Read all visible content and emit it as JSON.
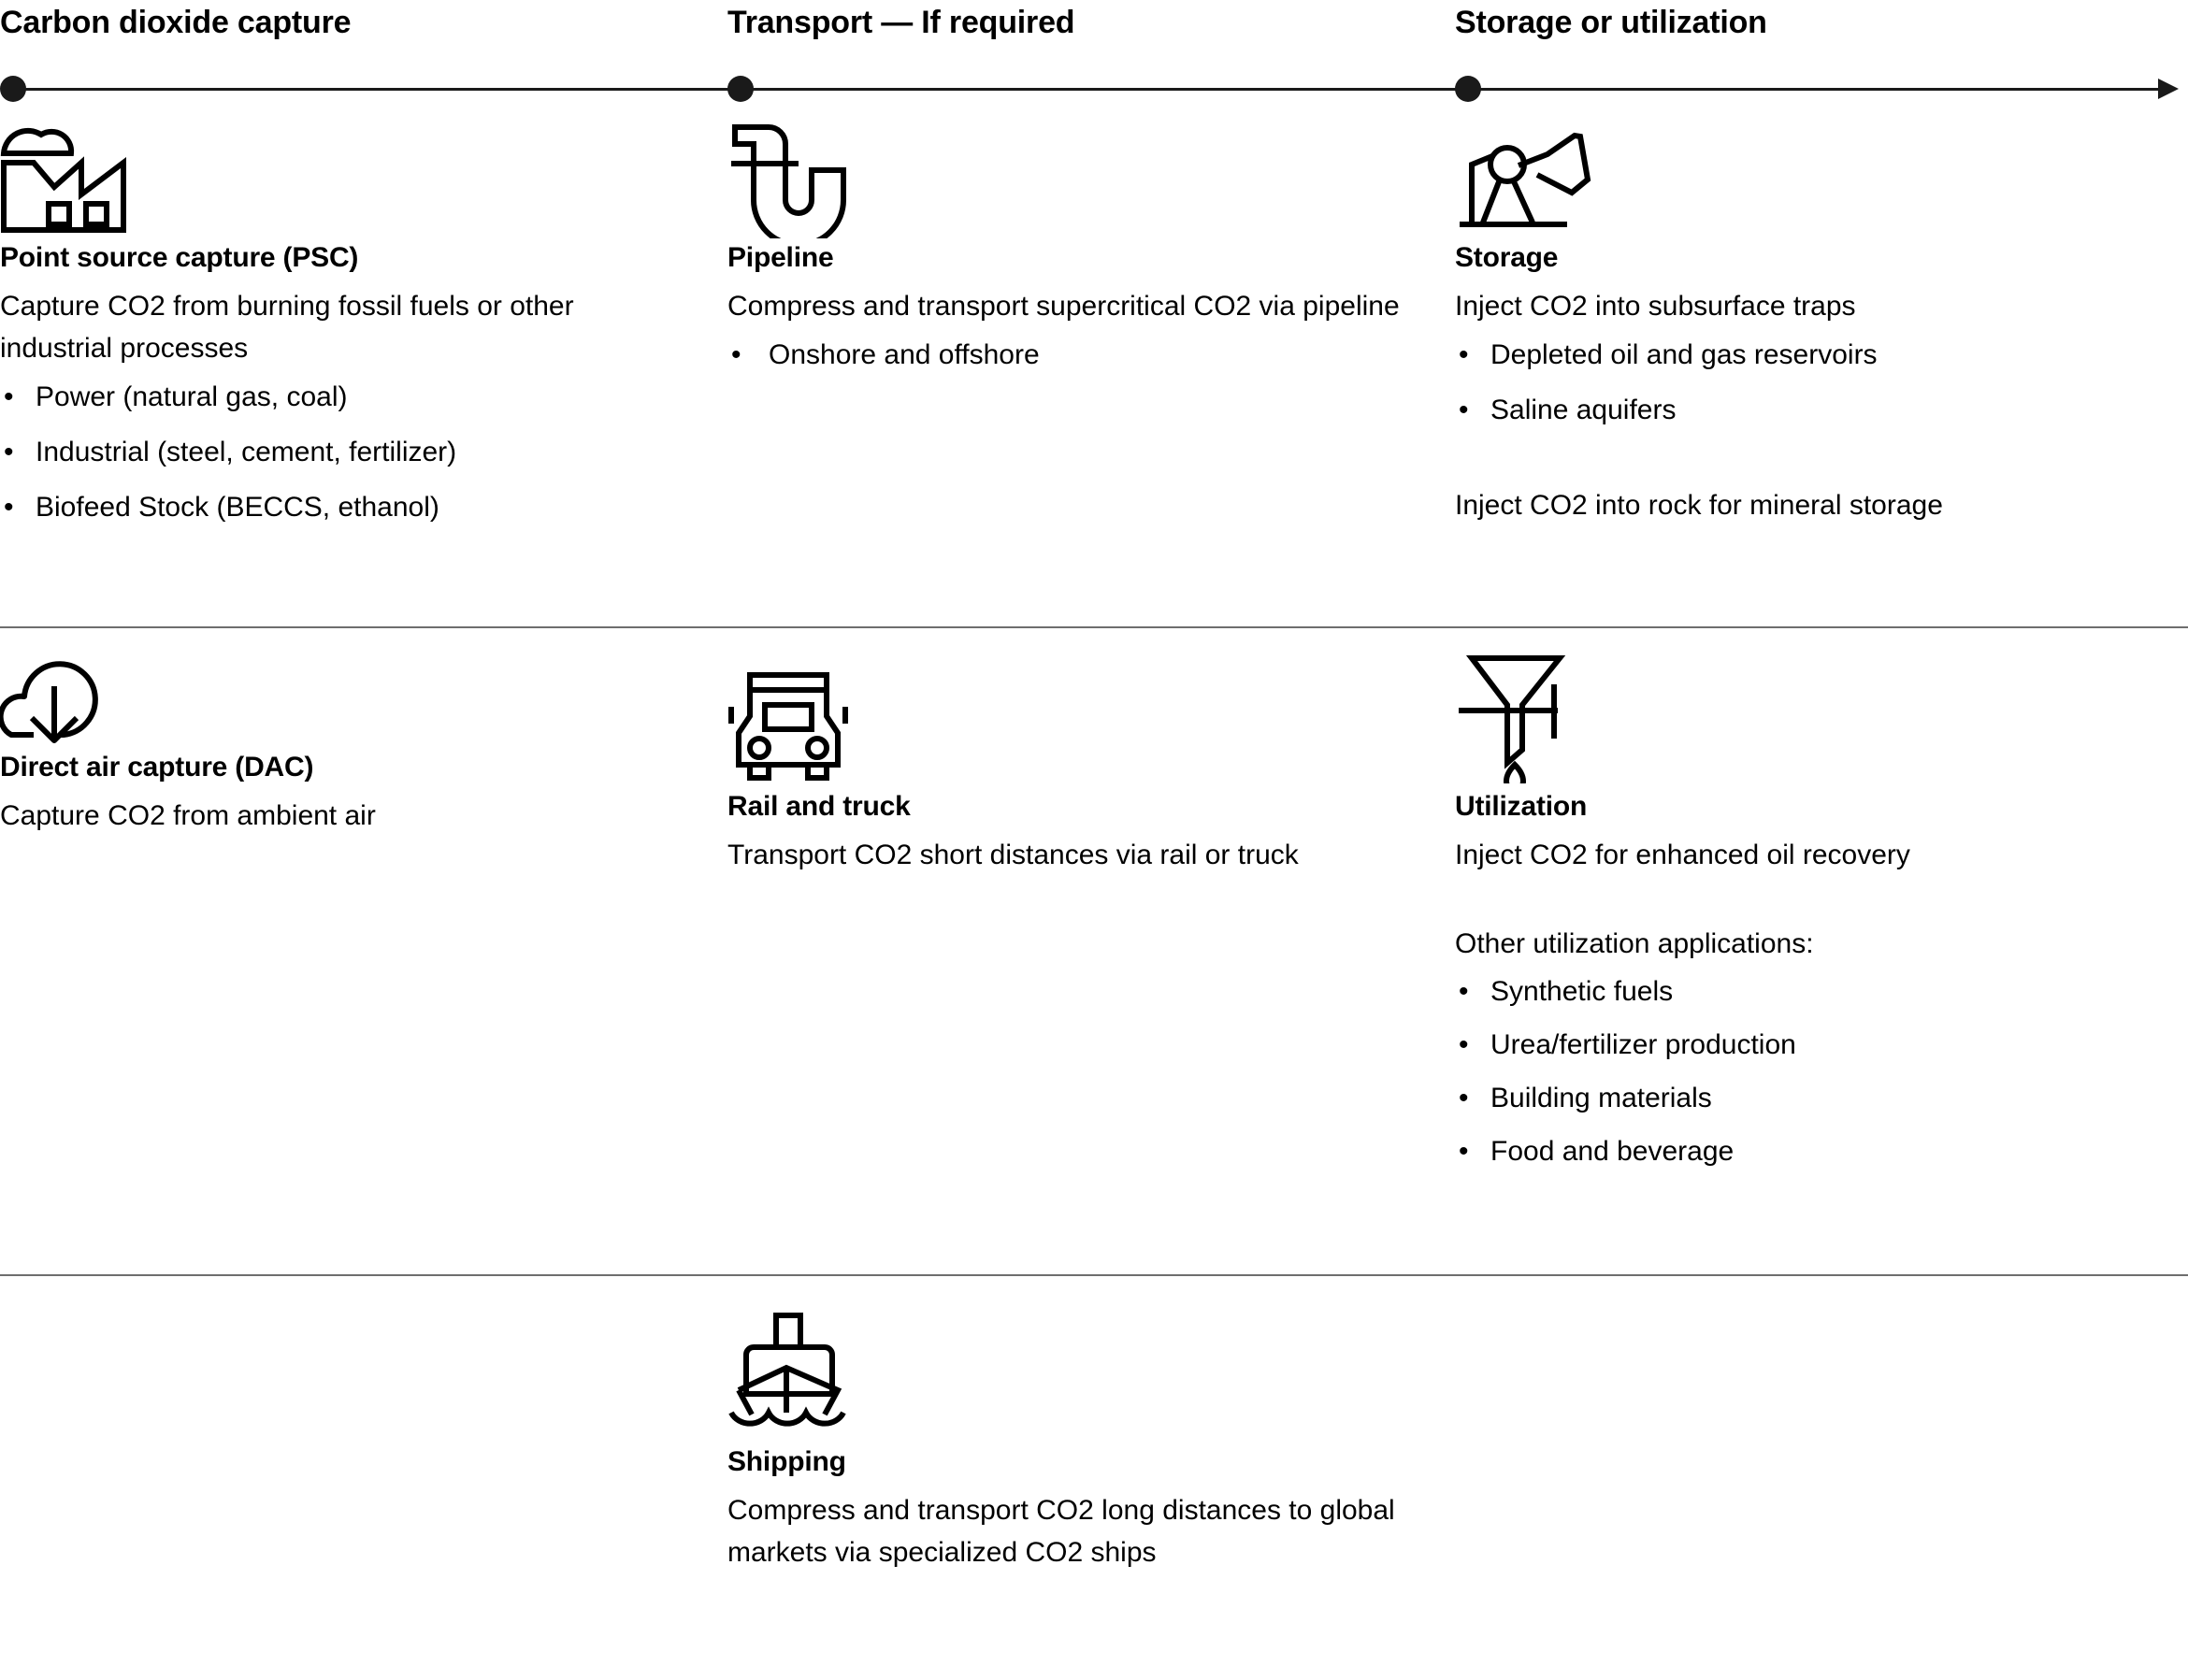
{
  "timeline": {
    "stages": [
      {
        "id": "capture",
        "label": "Carbon dioxide capture"
      },
      {
        "id": "transport",
        "label": "Transport — If required"
      },
      {
        "id": "storage",
        "label": "Storage or utilization"
      }
    ]
  },
  "cells": {
    "psc": {
      "icon": "factory-icon",
      "heading": "Point source capture (PSC)",
      "description": "Capture CO2 from burning fossil fuels or other industrial processes",
      "bullets": [
        "Power (natural gas, coal)",
        "Industrial (steel, cement, fertilizer)",
        "Biofeed Stock (BECCS, ethanol)"
      ]
    },
    "dac": {
      "icon": "cloud-down-arrow-icon",
      "heading": "Direct air capture (DAC)",
      "description": "Capture CO2 from ambient air",
      "bullets": []
    },
    "pipeline": {
      "icon": "pipe-icon",
      "heading": "Pipeline",
      "description": "Compress and transport supercritical CO2 via pipeline",
      "bullets": [
        "Onshore and offshore"
      ]
    },
    "rail_truck": {
      "icon": "truck-icon",
      "heading": "Rail and truck",
      "description": "Transport CO2 short distances via rail or truck",
      "bullets": []
    },
    "shipping": {
      "icon": "ship-icon",
      "heading": "Shipping",
      "description": "Compress and transport CO2 long distances to global markets via specialized CO2 ships",
      "bullets": []
    },
    "storage": {
      "icon": "pumpjack-icon",
      "heading": "Storage",
      "description": "Inject CO2 into subsurface traps",
      "bullets": [
        "Depleted oil and gas reservoirs",
        "Saline aquifers"
      ],
      "description2": "Inject CO2 into rock for mineral storage"
    },
    "utilization": {
      "icon": "funnel-drop-icon",
      "heading": "Utilization",
      "description": "Inject CO2 for enhanced oil recovery",
      "description2": "Other utilization applications:",
      "bullets": [
        "Synthetic fuels",
        "Urea/fertilizer production",
        "Building materials",
        "Food and beverage"
      ]
    }
  },
  "colors": {
    "ink": "#000000",
    "axis": "#1a1a1a",
    "divider": "#6e6e6e",
    "background": "#ffffff"
  }
}
